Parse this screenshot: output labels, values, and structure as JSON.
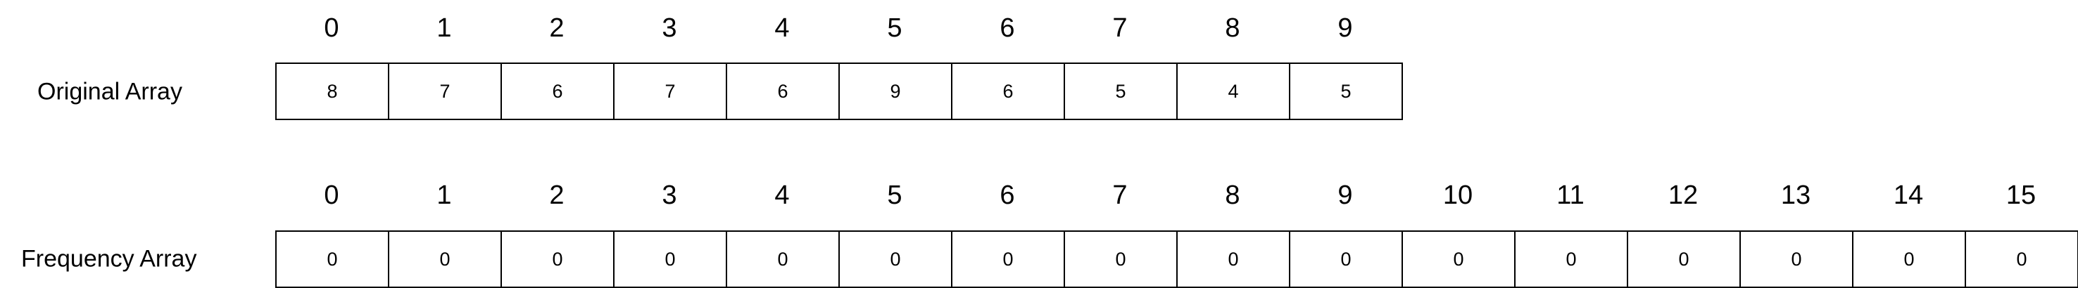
{
  "original": {
    "label": "Original Array",
    "indices": [
      "0",
      "1",
      "2",
      "3",
      "4",
      "5",
      "6",
      "7",
      "8",
      "9"
    ],
    "values": [
      "8",
      "7",
      "6",
      "7",
      "6",
      "9",
      "6",
      "5",
      "4",
      "5"
    ]
  },
  "frequency": {
    "label": "Frequency Array",
    "indices": [
      "0",
      "1",
      "2",
      "3",
      "4",
      "5",
      "6",
      "7",
      "8",
      "9",
      "10",
      "11",
      "12",
      "13",
      "14",
      "15"
    ],
    "values": [
      "0",
      "0",
      "0",
      "0",
      "0",
      "0",
      "0",
      "0",
      "0",
      "0",
      "0",
      "0",
      "0",
      "0",
      "0",
      "0"
    ]
  }
}
